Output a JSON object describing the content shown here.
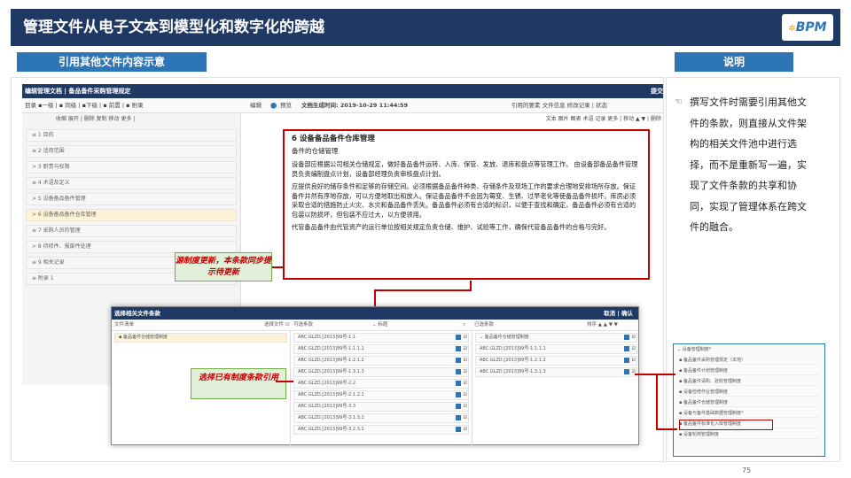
{
  "header": {
    "title": "管理文件从电子文本到模型化和数字化的跨越",
    "logo": "BPM"
  },
  "left_section": {
    "label": "引用其他文件内容示意"
  },
  "right_section": {
    "label": "说明"
  },
  "app": {
    "title": "编辑管理文档 | 备品备件采购管理规定",
    "save_label": "提交",
    "toolbar_left": "目录    ▪一级 | ▪ 同级 | ▪下级 | ▪ 前置 | ▪ 附录",
    "mode_edit": "编辑",
    "mode_preview": "预览",
    "gen_time": "文档生成时间: 2019-10-29 11:44:59",
    "toolbar_right": "引用的要素  文件信息  修改记录 | 状态",
    "sidebar_tools": "收缩  展开 | 删除  复制  移动  更多 |",
    "editor_tools": "文本  图片  图表  术语  记录  更多 | 移动 ▲ ▼ | 删除",
    "toc": [
      "≡ 1 目的",
      "≡ 2 适用范围",
      "> 3 职责与权限",
      "≡ 4 术语及定义",
      "> 5 设备备品备件管理",
      "> 6 设备备品备件仓库管理",
      "≡ 7 采购人员的管理",
      "> 8 待修件、报废件处理",
      "≡ 9 相关记录",
      "≡ 附录 1"
    ],
    "toc_selected_index": 5
  },
  "content": {
    "heading": "6  设备备品备件仓库管理",
    "subheading": "备件的仓储管理",
    "paragraphs": [
      "设备部应根据公司相关仓储规定，做好备品备件运转、入库、保管、发放、退库和盘点等管理工作。 由设备部备品备件管理员负责编制盘点计划，设备部经理负责审核盘点计划。",
      "应提供良好的储存条件和足够的存储空间。必须根据备品备件种类、存储条件及现场工作的要求合理地安排场所存放。保证备件井然有序地存放，可以方便地取出和放入。保证备品备件不会因为霉变、生锈、过早老化等使备品备件损坏。库房必须采取合适的措施防止火灾、水灾和备品备件丢失。备品备件必须有合适的标识，以便于查找和确定。备品备件必须有合适的包装以防损坏，但包装不应过大，以方便领用。",
      "代管备品备件由代管资产的运行单位按相关规定负责仓储、维护、试验等工作，确保代管备品备件的合格与完好。"
    ]
  },
  "callouts": {
    "sync": "源制度更新，本条款同步提示待更新",
    "select": "选择已有制度条款引用"
  },
  "dialog": {
    "title": "选择相关文件条款",
    "cancel": "取消",
    "confirm": "确认",
    "col1_header": "文件清单",
    "col1_action": "选择文件 ☑",
    "col2_header": "可选条款",
    "col2_filter": "⌄ 标题",
    "col3_header": "已选条款",
    "col3_sort": "排序 ▲ ▲ ▼ ▼",
    "files": [
      "▪ 备品备件仓储管理制度"
    ],
    "available": [
      "ABC.GLZD.[2013]99号-1.1",
      "ABC.GLZD.[2013]99号-1.1.1.1",
      "ABC.GLZD.[2013]99号-1.2.1.2",
      "ABC.GLZD.[2013]99号-1.3.1.3",
      "ABC.GLZD.[2013]99号-2.2",
      "ABC.GLZD.[2013]99号-2.1.2.1",
      "ABC.GLZD.[2013]99号-3.3",
      "ABC.GLZD.[2013]99号-3.1.3.1",
      "ABC.GLZD.[2013]99号-3.2.3.2"
    ],
    "selected": [
      "⌄ 备品备件仓储管理制度",
      "ABC.GLZD.[2013]99号-1.1.1.1",
      "ABC.GLZD.[2013]99号-1.2.1.2",
      "ABC.GLZD.[2013]99号-1.3.1.3"
    ]
  },
  "description": "撰写文件时需要引用其他文件的条款，则直接从文件架构的相关文件池中进行选择，而不是重新写一遍，实现了文件条款的共享和协同，实现了管理体系在跨文件的融合。",
  "tree": {
    "title": "⌄ 设备管理制度*",
    "items": [
      "▪ 备品备件采购管理规定（本地）",
      "▪ 备品备件计划管理制度",
      "▪ 备品备件请购、验收管理制度",
      "▪ 设备检修作业管理制度",
      "▪ 备品备件仓储管理制度",
      "▪ 设备与备件基础数据管理制度*",
      "▪ 备品备件标准化入库管理制度",
      "▪ 设备轮岗管理制度"
    ]
  },
  "page_number": "75"
}
